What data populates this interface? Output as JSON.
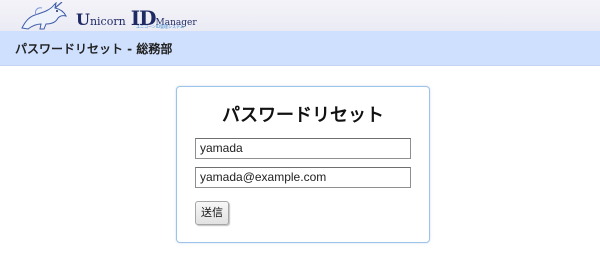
{
  "header": {
    "logo": {
      "u": "U",
      "nicorn": "nicorn",
      "id": "ID",
      "manager": "Manager",
      "tagline": "ユニコーンID管理システム"
    },
    "subtitle": "パスワードリセット - 総務部"
  },
  "form": {
    "title": "パスワードリセット",
    "username_value": "yamada",
    "email_value": "yamada@example.com",
    "submit_label": "送信"
  },
  "colors": {
    "subbar_bg": "#cfe0ff",
    "card_border": "#9cc4ea",
    "logo_text": "#1f2a64"
  }
}
